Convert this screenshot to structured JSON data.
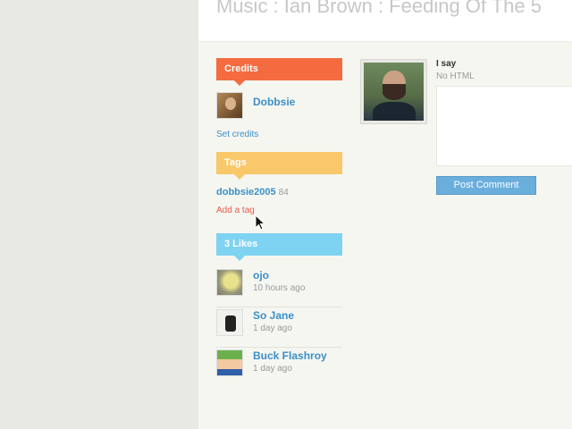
{
  "page": {
    "title": "Music : Ian Brown : Feeding Of The 5"
  },
  "credits": {
    "header": "Credits",
    "items": [
      {
        "name": "Dobbsie"
      }
    ],
    "set_credits_link": "Set credits"
  },
  "tags": {
    "header": "Tags",
    "items": [
      {
        "name": "dobbsie2005",
        "count": "84"
      }
    ],
    "add_tag_link": "Add a tag"
  },
  "likes": {
    "header": "3 Likes",
    "items": [
      {
        "name": "ojo",
        "time": "10 hours ago"
      },
      {
        "name": "So Jane",
        "time": "1 day ago"
      },
      {
        "name": "Buck Flashroy",
        "time": "1 day ago"
      }
    ]
  },
  "comment": {
    "label": "I say",
    "hint": "No HTML",
    "placeholder": "",
    "post_button": "Post Comment"
  },
  "colors": {
    "credits_header": "#f36b3f",
    "tags_header": "#f8c86a",
    "likes_header": "#7fd3f2",
    "link": "#3b8fc7",
    "add_tag": "#e85a4f",
    "button": "#6aaedc"
  },
  "icons": {
    "cursor": "mouse-pointer-icon"
  }
}
